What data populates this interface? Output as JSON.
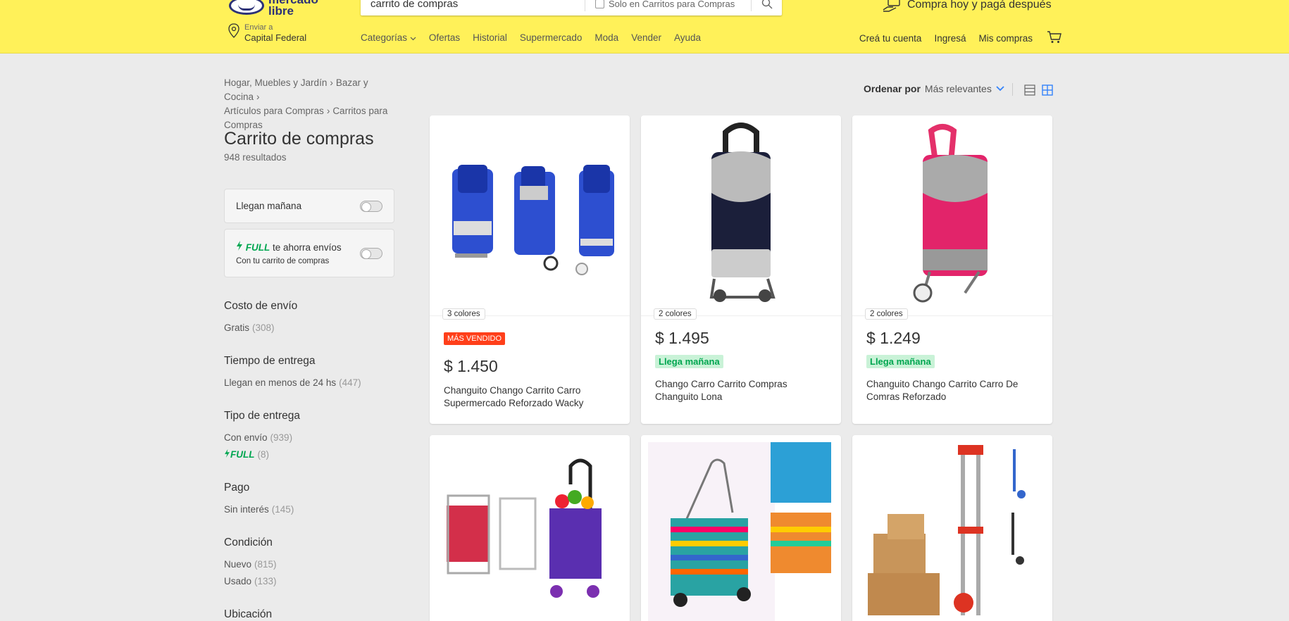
{
  "header": {
    "search_value": "carrito de compras",
    "search_filter_label": "Solo en Carritos para Compras",
    "promo_text": "Compra hoy y pagá después",
    "logo_text_1": "mercado",
    "logo_text_2": "libre",
    "location_small": "Enviar a",
    "location_big": "Capital Federal",
    "nav": [
      "Categorías",
      "Ofertas",
      "Historial",
      "Supermercado",
      "Moda",
      "Vender",
      "Ayuda"
    ],
    "user_nav": [
      "Creá tu cuenta",
      "Ingresá",
      "Mis compras"
    ],
    "colors": {
      "header_bg": "#fff159",
      "brand": "#2d3277"
    }
  },
  "breadcrumb": [
    "Hogar, Muebles y Jardín",
    "Bazar y Cocina",
    "Artículos para Compras",
    "Carritos para Compras"
  ],
  "page": {
    "title": "Carrito de compras",
    "results": "948 resultados"
  },
  "toggles": {
    "llegan": "Llegan mañana",
    "full_word": "FULL",
    "full_rest": " te ahorra envíos",
    "full_sub": "Con tu carrito de compras"
  },
  "filters": [
    {
      "title": "Costo de envío",
      "items": [
        {
          "label": "Gratis",
          "count": "(308)"
        }
      ]
    },
    {
      "title": "Tiempo de entrega",
      "items": [
        {
          "label": "Llegan en menos de 24 hs",
          "count": "(447)"
        }
      ]
    },
    {
      "title": "Tipo de entrega",
      "items": [
        {
          "label": "Con envío",
          "count": "(939)"
        },
        {
          "label": "FULL",
          "count": "(8)"
        }
      ]
    },
    {
      "title": "Pago",
      "items": [
        {
          "label": "Sin interés",
          "count": "(145)"
        }
      ]
    },
    {
      "title": "Condición",
      "items": [
        {
          "label": "Nuevo",
          "count": "(815)"
        },
        {
          "label": "Usado",
          "count": "(133)"
        }
      ]
    },
    {
      "title": "Ubicación",
      "items": []
    }
  ],
  "sort": {
    "label": "Ordenar por",
    "value": "Más relevantes"
  },
  "products": [
    {
      "colors": "3 colores",
      "badge": "MÁS VENDIDO",
      "price": "$ 1.450",
      "title": "Changuito Chango Carrito Carro Supermercado Reforzado Wacky"
    },
    {
      "colors": "2 colores",
      "shipping": "Llega mañana",
      "price": "$ 1.495",
      "title": "Chango Carro Carrito Compras Changuito Lona"
    },
    {
      "colors": "2 colores",
      "shipping": "Llega mañana",
      "price": "$ 1.249",
      "title": "Changuito Chango Carrito Carro De Comras Reforzado"
    }
  ]
}
